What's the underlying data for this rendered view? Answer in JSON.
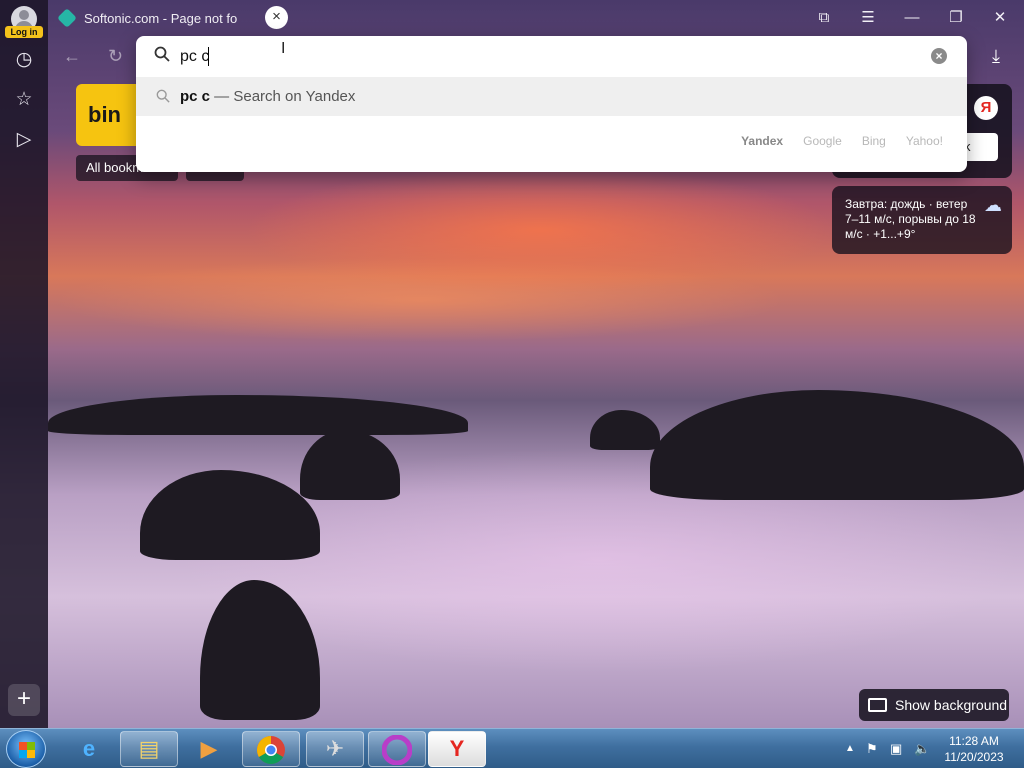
{
  "tab": {
    "title": "Softonic.com - Page not fo",
    "close_icon": "×"
  },
  "sidebar": {
    "login_label": "Log in",
    "add_label": "+"
  },
  "window_controls": {
    "bookmarks": "⧉",
    "menu": "☰",
    "minimize": "—",
    "restore": "❐",
    "close": "✕"
  },
  "search": {
    "query": "pc c",
    "suggestion_bold": "pc c",
    "suggestion_rest": " — Search on Yandex",
    "engines": [
      "Yandex",
      "Google",
      "Bing",
      "Yahoo!"
    ],
    "active_engine": "Yandex"
  },
  "bookmarks_bar": {
    "all_bookmarks": "All bookmarks",
    "recent": "Recent"
  },
  "bing_tile": {
    "label": "bin"
  },
  "yandex_card": {
    "logo": "Я",
    "button": "k"
  },
  "weather": {
    "text": "Завтра: дождь · ветер 7–11 м/с, порывы до 18 м/с · +1...+9°"
  },
  "show_background": {
    "label": "Show background"
  },
  "taskbar": {
    "time": "11:28 AM",
    "date": "11/20/2023"
  }
}
